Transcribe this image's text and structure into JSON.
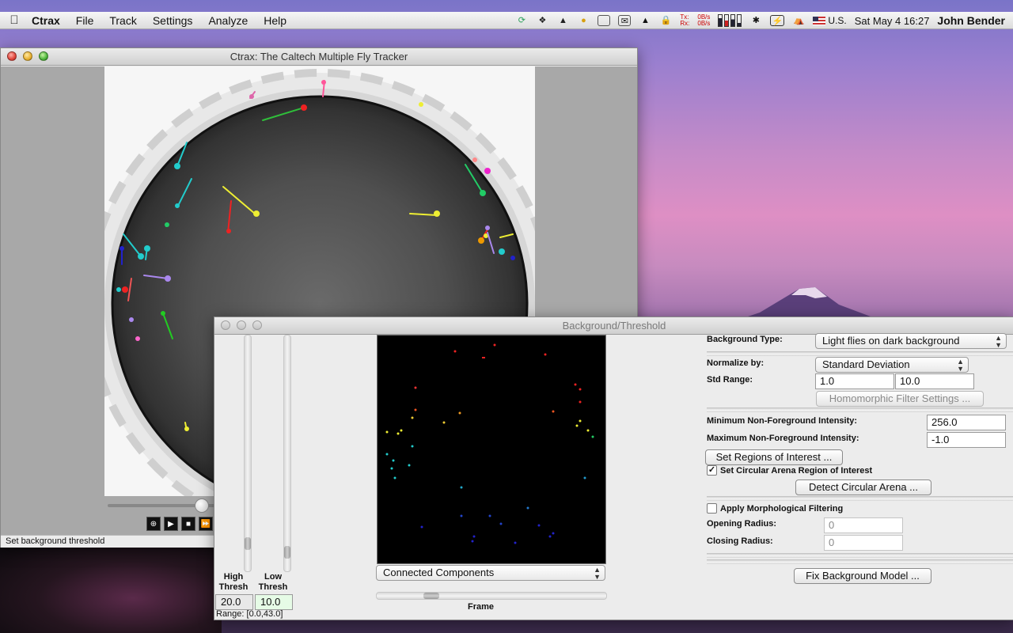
{
  "menubar": {
    "app_name": "Ctrax",
    "menus": [
      "File",
      "Track",
      "Settings",
      "Analyze",
      "Help"
    ],
    "status": {
      "net_tx_rate": "0B/s",
      "net_rx_rate": "0B/s",
      "net_tx_label": "Tx:",
      "net_rx_label": "Rx:",
      "input_source": "U.S.",
      "datetime": "Sat May 4  16:27",
      "user": "John Bender"
    }
  },
  "main_window": {
    "title": "Ctrax: The Caltech Multiple Fly Tracker",
    "status_text": "Set background threshold",
    "frame_slider_fraction": 0.4
  },
  "bg_window": {
    "title": "Background/Threshold",
    "high_thresh_label": "High\nThresh",
    "low_thresh_label": "Low\nThresh",
    "high_thresh_value": "20.0",
    "low_thresh_value": "10.0",
    "range_text": "Range: [0.0,43.0]",
    "view_select": "Connected Components",
    "frame_label": "Frame",
    "background_type_label": "Background Type:",
    "background_type_value": "Light flies on dark background",
    "normalize_label": "Normalize by:",
    "normalize_value": "Standard Deviation",
    "std_range_label": "Std Range:",
    "std_range_min": "1.0",
    "std_range_max": "10.0",
    "homomorphic_button": "Homomorphic Filter Settings ...",
    "min_nonfg_label": "Minimum Non-Foreground Intensity:",
    "min_nonfg_value": "256.0",
    "max_nonfg_label": "Maximum Non-Foreground Intensity:",
    "max_nonfg_value": "-1.0",
    "roi_button": "Set Regions of Interest ...",
    "circular_arena_check_label": "Set Circular Arena Region of Interest",
    "circular_arena_checked": true,
    "detect_arena_button": "Detect Circular Arena ...",
    "morph_check_label": "Apply Morphological Filtering",
    "morph_checked": false,
    "opening_radius_label": "Opening Radius:",
    "opening_radius_value": "0",
    "closing_radius_label": "Closing Radius:",
    "closing_radius_value": "0",
    "fix_bg_button": "Fix Background Model ..."
  }
}
